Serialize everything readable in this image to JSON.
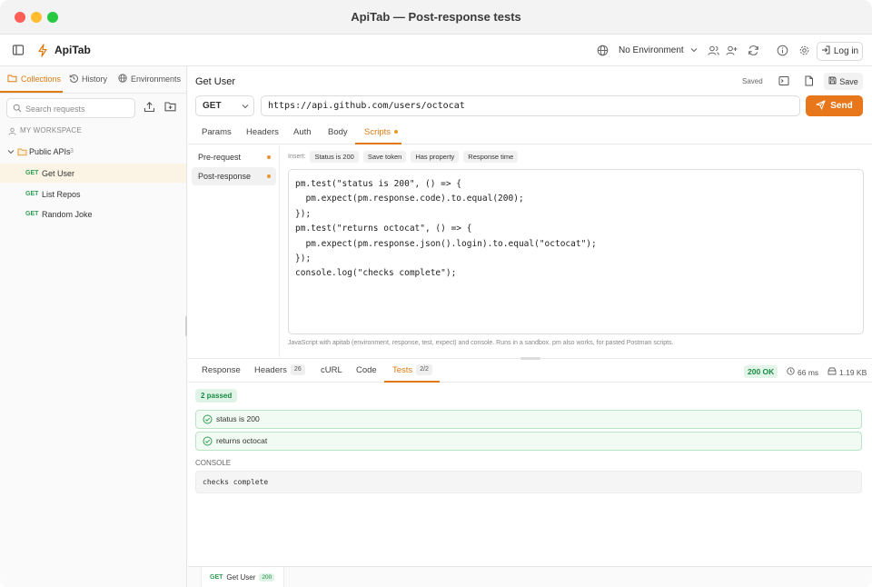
{
  "window": {
    "title": "ApiTab — Post-response tests"
  },
  "header": {
    "app_name": "ApiTab",
    "environment": "No Environment",
    "login_label": "Log in"
  },
  "sidebar": {
    "tabs": [
      {
        "label": "Collections",
        "active": true
      },
      {
        "label": "History",
        "active": false
      },
      {
        "label": "Environments",
        "active": false
      }
    ],
    "search_placeholder": "Search requests",
    "workspace_label": "MY WORKSPACE",
    "folder": {
      "name": "Public APIs",
      "count": "3"
    },
    "requests": [
      {
        "method": "GET",
        "name": "Get User",
        "active": true
      },
      {
        "method": "GET",
        "name": "List Repos",
        "active": false
      },
      {
        "method": "GET",
        "name": "Random Joke",
        "active": false
      }
    ]
  },
  "request": {
    "title": "Get User",
    "saved_label": "Saved",
    "save_label": "Save",
    "method": "GET",
    "url": "https://api.github.com/users/octocat",
    "send_label": "Send",
    "tabs": [
      "Params",
      "Headers",
      "Auth",
      "Body",
      "Scripts"
    ],
    "active_tab": "Scripts"
  },
  "scripts": {
    "nav": [
      {
        "label": "Pre-request",
        "active": false
      },
      {
        "label": "Post-response",
        "active": true
      }
    ],
    "insert_label": "Insert:",
    "snippets": [
      "Status is 200",
      "Save token",
      "Has property",
      "Response time"
    ],
    "code_lines": [
      "pm.test(\"status is 200\", () => {",
      "  pm.expect(pm.response.code).to.equal(200);",
      "});",
      "pm.test(\"returns octocat\", () => {",
      "  pm.expect(pm.response.json().login).to.equal(\"octocat\");",
      "});",
      "console.log(\"checks complete\");"
    ],
    "hint": "JavaScript with apitab (environment, response, test, expect) and console. Runs in a sandbox. pm also works, for pasted Postman scripts."
  },
  "response": {
    "tabs": [
      {
        "label": "Response",
        "count": ""
      },
      {
        "label": "Headers",
        "count": "26"
      },
      {
        "label": "cURL",
        "count": ""
      },
      {
        "label": "Code",
        "count": ""
      },
      {
        "label": "Tests",
        "count": "2/2"
      }
    ],
    "active_tab": "Tests",
    "status": "200 OK",
    "time": "66 ms",
    "size": "1.19 KB",
    "passed_label": "2 passed",
    "tests": [
      "status is 200",
      "returns octocat"
    ],
    "console_label": "CONSOLE",
    "console_output": "checks complete"
  },
  "bottom_tab": {
    "method": "GET",
    "name": "Get User",
    "status": "200"
  },
  "colors": {
    "accent": "#e8771b",
    "success": "#1a8a45",
    "get_method": "#2f9e55"
  }
}
